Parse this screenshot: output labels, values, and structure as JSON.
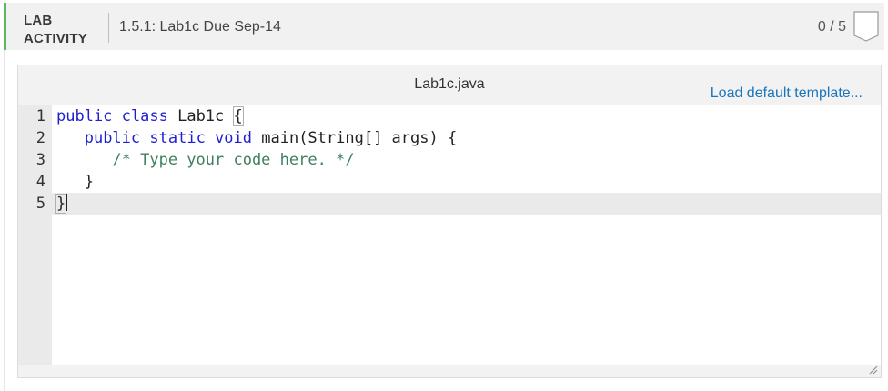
{
  "header": {
    "lab_label_line1": "LAB",
    "lab_label_line2": "ACTIVITY",
    "activity_title": "1.5.1: Lab1c Due Sep-14",
    "score": "0 / 5",
    "accent_color": "#5cb85c"
  },
  "editor": {
    "file_name": "Lab1c.java",
    "load_default_label": "Load default template...",
    "lines": [
      {
        "number": "1",
        "text": "public class Lab1c {"
      },
      {
        "number": "2",
        "text": "   public static void main(String[] args) {"
      },
      {
        "number": "3",
        "text": "      /* Type your code here. */"
      },
      {
        "number": "4",
        "text": "   }"
      },
      {
        "number": "5",
        "text": "}"
      }
    ],
    "active_line": "5",
    "keyword_color": "#1f1fd1",
    "comment_color": "#3f7f5f"
  },
  "icons": {
    "badge": "badge-outline-icon",
    "resize": "resize-grip-icon"
  }
}
